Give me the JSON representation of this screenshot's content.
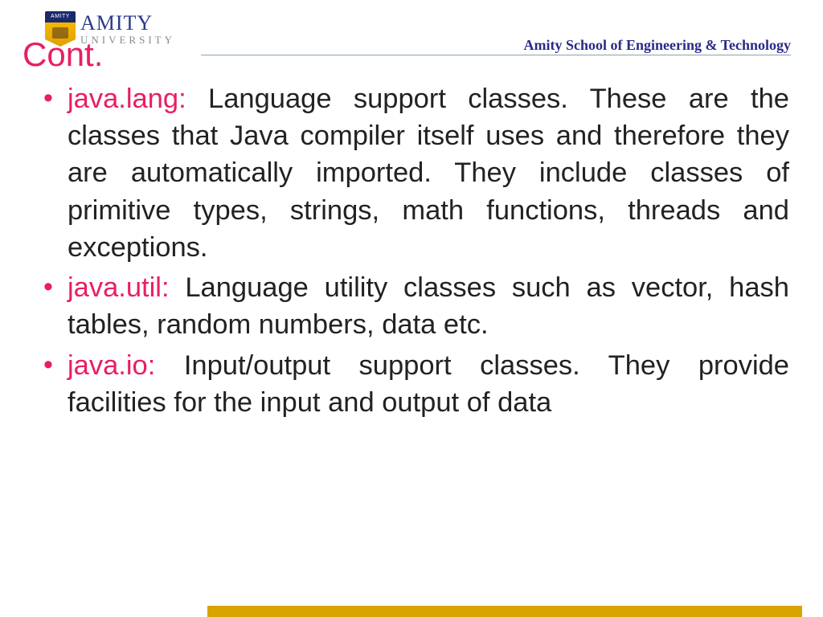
{
  "header": {
    "logo_top_text": "AMITY",
    "logo_main": "AMITY",
    "logo_sub": "UNIVERSITY",
    "school_name": "Amity School of Engineering & Technology"
  },
  "slide": {
    "title": "Cont.",
    "bullets": [
      {
        "package": "java.lang:",
        "body": " Language support classes. These are the classes that Java compiler itself uses and therefore they are automatically imported. They include classes of primitive types, strings, math functions, threads and exceptions."
      },
      {
        "package": "java.util:",
        "body": " Language utility classes such as vector, hash tables, random numbers, data etc."
      },
      {
        "package": "java.io:",
        "body": " Input/output support classes. They provide facilities for the input and output of data"
      }
    ]
  },
  "colors": {
    "accent": "#e91e63",
    "navy": "#2a2a8a",
    "gold": "#d9a400"
  }
}
